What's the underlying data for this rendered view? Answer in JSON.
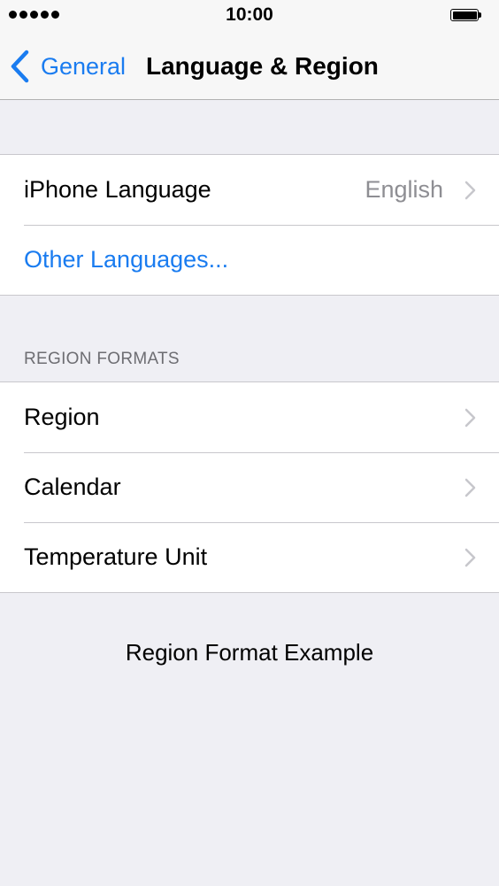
{
  "status_bar": {
    "time": "10:00",
    "signal_bars": 5,
    "battery_level": 1.0
  },
  "nav": {
    "back_label": "General",
    "title": "Language & Region"
  },
  "language_group": {
    "iphone_language_label": "iPhone Language",
    "iphone_language_value": "English",
    "other_languages_label": "Other Languages..."
  },
  "region_formats": {
    "header": "REGION FORMATS",
    "items": [
      {
        "label": "Region"
      },
      {
        "label": "Calendar"
      },
      {
        "label": "Temperature Unit"
      }
    ]
  },
  "example": {
    "label": "Region Format Example"
  },
  "colors": {
    "accent": "#1a7cf0",
    "background": "#efeff4",
    "secondary_text": "#8e8e93"
  }
}
